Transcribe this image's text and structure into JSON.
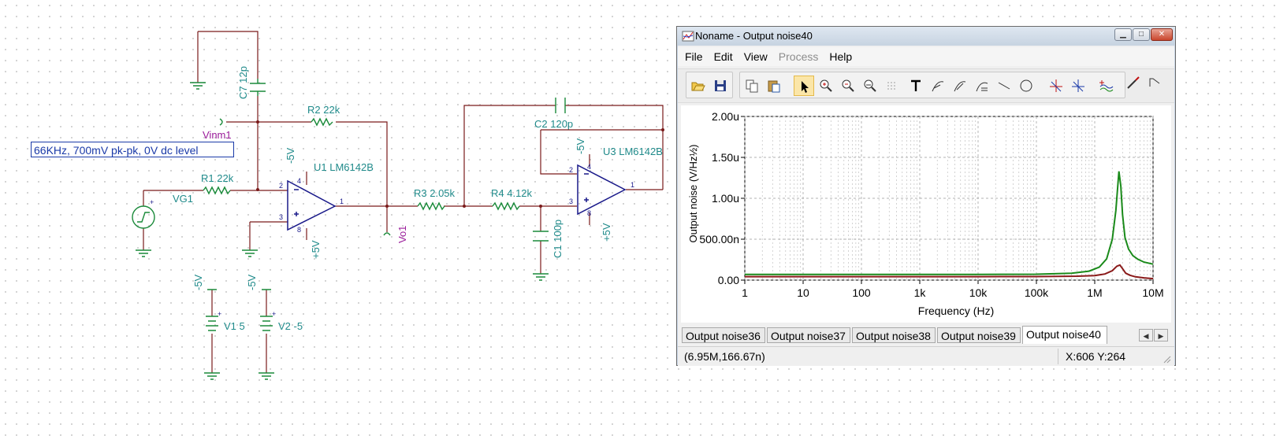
{
  "schematic": {
    "annotation": "66KHz, 700mV pk-pk, 0V dc level",
    "components": {
      "c7": "C7 12p",
      "r2": "R2 22k",
      "r1": "R1 22k",
      "u1": "U1 LM6142B",
      "r3": "R3 2.05k",
      "r4": "R4 4.12k",
      "c2": "C2 120p",
      "u3": "U3 LM6142B",
      "c1": "C1 100p",
      "v1": "V1 5",
      "v2": "V2 -5"
    },
    "nets": {
      "vinm1": "Vinm1",
      "vg1": "VG1",
      "vo1": "Vo1"
    },
    "supplies": {
      "neg": "-5V",
      "pos": "+5V"
    },
    "pins": {
      "p1": "1",
      "p2": "2",
      "p3": "3",
      "p4": "4",
      "p8": "8",
      "minus": "-",
      "plus": "+"
    }
  },
  "window": {
    "title": "Noname - Output noise40",
    "controls": {
      "min": "▁",
      "max": "□",
      "close": "✕"
    },
    "menu": {
      "file": "File",
      "edit": "Edit",
      "view": "View",
      "process": "Process",
      "help": "Help"
    },
    "toolbar_icons": [
      "open-icon",
      "save-icon",
      "copy-icon",
      "paste-icon",
      "pointer-icon",
      "zoom-in-icon",
      "zoom-out-icon",
      "zoom-100-icon",
      "grid-icon",
      "text-icon",
      "cursor-a-icon",
      "cursor-b-icon",
      "annotate-icon",
      "line-icon",
      "circle-icon",
      "cursor-a-place-icon",
      "cursor-b-place-icon",
      "wave-add-icon",
      "probe-icon",
      "step-icon"
    ],
    "tabs": [
      "Output noise36",
      "Output noise37",
      "Output noise38",
      "Output noise39",
      "Output noise40"
    ],
    "active_tab": "Output noise40",
    "tab_arrows": {
      "left": "◀",
      "right": "▶"
    },
    "status": {
      "cursor_value": "(6.95M,166.67n)",
      "xy": "X:606  Y:264"
    }
  },
  "chart_data": {
    "type": "line",
    "ylabel": "Output noise (V/Hz½)",
    "xlabel": "Frequency (Hz)",
    "xscale": "log",
    "xlim": [
      1,
      10000000
    ],
    "ylim": [
      0,
      2e-06
    ],
    "x_ticks": [
      {
        "value": 1,
        "label": "1"
      },
      {
        "value": 10,
        "label": "10"
      },
      {
        "value": 100,
        "label": "100"
      },
      {
        "value": 1000,
        "label": "1k"
      },
      {
        "value": 10000,
        "label": "10k"
      },
      {
        "value": 100000,
        "label": "100k"
      },
      {
        "value": 1000000,
        "label": "1M"
      },
      {
        "value": 10000000,
        "label": "10M"
      }
    ],
    "y_ticks": [
      {
        "value": 0,
        "label": "0.00"
      },
      {
        "value": 5e-07,
        "label": "500.00n"
      },
      {
        "value": 1e-06,
        "label": "1.00u"
      },
      {
        "value": 1.5e-06,
        "label": "1.50u"
      },
      {
        "value": 2e-06,
        "label": "2.00u"
      }
    ],
    "grid": true,
    "series": [
      {
        "color": "#1a8a1a",
        "x": [
          1,
          10,
          100,
          1000,
          10000,
          100000,
          400000,
          800000,
          1200000,
          1600000,
          2000000,
          2300000,
          2600000,
          2800000,
          3000000,
          3300000,
          3800000,
          4500000,
          5500000,
          7000000,
          10000000
        ],
        "y": [
          7e-08,
          7e-08,
          7e-08,
          7e-08,
          7e-08,
          7.2e-08,
          8.5e-08,
          1.1e-07,
          1.6e-07,
          2.6e-07,
          5e-07,
          8.5e-07,
          1.33e-06,
          1.15e-06,
          8e-07,
          5.2e-07,
          3.8e-07,
          3e-07,
          2.55e-07,
          2.2e-07,
          1.95e-07
        ]
      },
      {
        "color": "#8a1a1a",
        "x": [
          1,
          10,
          100,
          1000,
          10000,
          100000,
          500000,
          1000000,
          1500000,
          2000000,
          2400000,
          2700000,
          3000000,
          3400000,
          4000000,
          5000000,
          7000000,
          10000000
        ],
        "y": [
          4.2e-08,
          4.2e-08,
          4.2e-08,
          4.2e-08,
          4.2e-08,
          4.3e-08,
          4.8e-08,
          5.6e-08,
          7.5e-08,
          1.15e-07,
          1.7e-07,
          1.85e-07,
          1.4e-07,
          8.5e-08,
          6e-08,
          4e-08,
          2.8e-08,
          1.8e-08
        ]
      }
    ]
  }
}
